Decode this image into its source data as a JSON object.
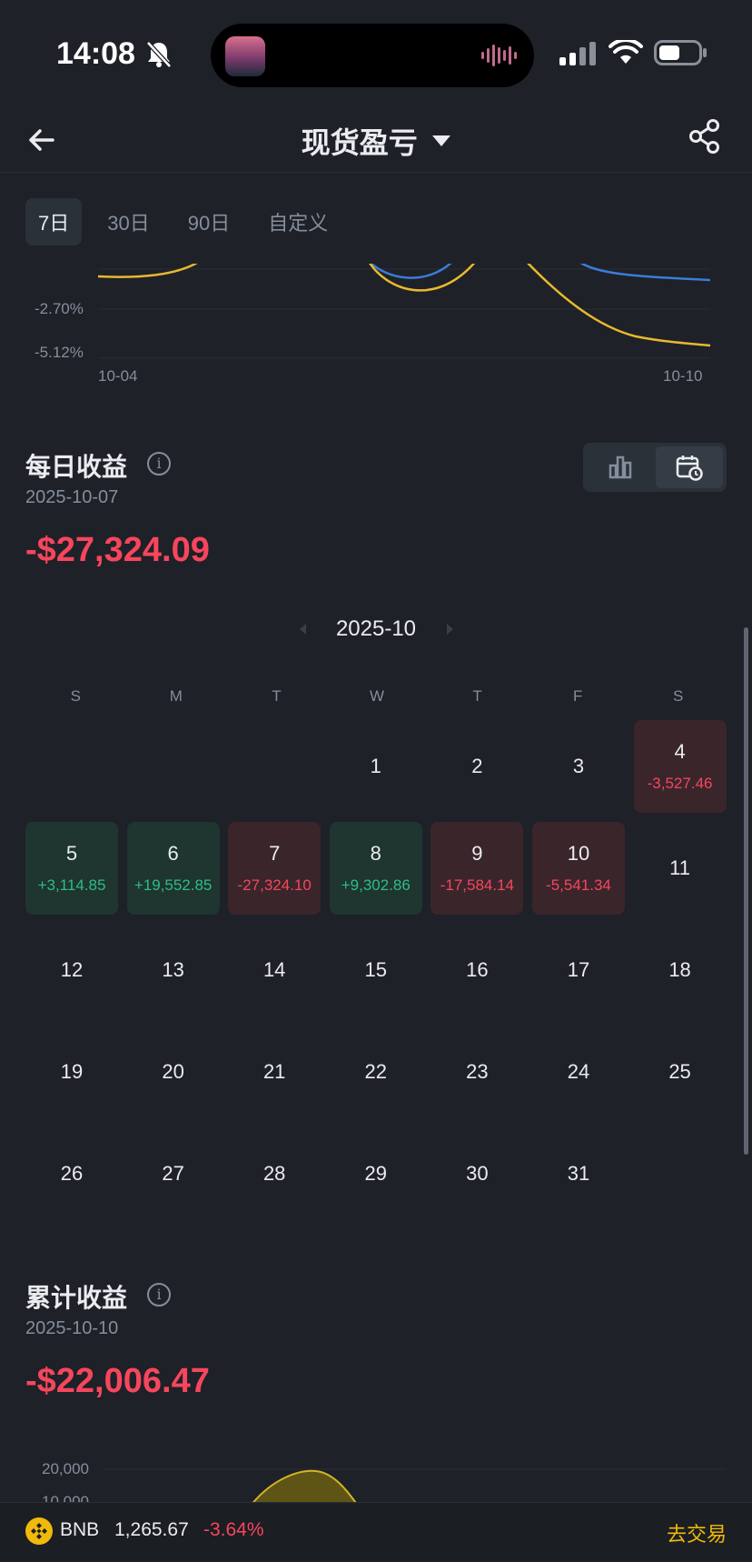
{
  "status_bar": {
    "time": "14:08",
    "icons": [
      "bell-off-icon",
      "signal-icon",
      "wifi-icon",
      "battery-icon"
    ]
  },
  "header": {
    "title": "现货盈亏",
    "icons": [
      "back-arrow-icon",
      "dropdown-caret-icon",
      "share-icon"
    ]
  },
  "range_tabs": [
    {
      "label": "7日",
      "active": true
    },
    {
      "label": "30日",
      "active": false
    },
    {
      "label": "90日",
      "active": false
    },
    {
      "label": "自定义",
      "active": false
    }
  ],
  "top_chart": {
    "y_labels": [
      "-2.70%",
      "-5.12%"
    ],
    "x_labels": [
      "10-04",
      "10-10"
    ],
    "colors": {
      "series_a": "#e8b92f",
      "series_b": "#3d7bd9"
    }
  },
  "daily": {
    "title": "每日收益",
    "date": "2025-10-07",
    "value": "-$27,324.09",
    "view_icons": [
      "bar-chart-icon",
      "calendar-icon"
    ],
    "month": "2025-10",
    "weekdays": [
      "S",
      "M",
      "T",
      "W",
      "T",
      "F",
      "S"
    ],
    "days": [
      {
        "day": "",
        "pnl": "",
        "type": "empty"
      },
      {
        "day": "",
        "pnl": "",
        "type": "empty"
      },
      {
        "day": "",
        "pnl": "",
        "type": "empty"
      },
      {
        "day": "1",
        "pnl": "",
        "type": "none"
      },
      {
        "day": "2",
        "pnl": "",
        "type": "none"
      },
      {
        "day": "3",
        "pnl": "",
        "type": "none"
      },
      {
        "day": "4",
        "pnl": "-3,527.46",
        "type": "neg"
      },
      {
        "day": "5",
        "pnl": "+3,114.85",
        "type": "pos"
      },
      {
        "day": "6",
        "pnl": "+19,552.85",
        "type": "pos"
      },
      {
        "day": "7",
        "pnl": "-27,324.10",
        "type": "neg"
      },
      {
        "day": "8",
        "pnl": "+9,302.86",
        "type": "pos"
      },
      {
        "day": "9",
        "pnl": "-17,584.14",
        "type": "neg"
      },
      {
        "day": "10",
        "pnl": "-5,541.34",
        "type": "neg"
      },
      {
        "day": "11",
        "pnl": "",
        "type": "none"
      },
      {
        "day": "12",
        "pnl": "",
        "type": "none"
      },
      {
        "day": "13",
        "pnl": "",
        "type": "none"
      },
      {
        "day": "14",
        "pnl": "",
        "type": "none"
      },
      {
        "day": "15",
        "pnl": "",
        "type": "none"
      },
      {
        "day": "16",
        "pnl": "",
        "type": "none"
      },
      {
        "day": "17",
        "pnl": "",
        "type": "none"
      },
      {
        "day": "18",
        "pnl": "",
        "type": "none"
      },
      {
        "day": "19",
        "pnl": "",
        "type": "none"
      },
      {
        "day": "20",
        "pnl": "",
        "type": "none"
      },
      {
        "day": "21",
        "pnl": "",
        "type": "none"
      },
      {
        "day": "22",
        "pnl": "",
        "type": "none"
      },
      {
        "day": "23",
        "pnl": "",
        "type": "none"
      },
      {
        "day": "24",
        "pnl": "",
        "type": "none"
      },
      {
        "day": "25",
        "pnl": "",
        "type": "none"
      },
      {
        "day": "26",
        "pnl": "",
        "type": "none"
      },
      {
        "day": "27",
        "pnl": "",
        "type": "none"
      },
      {
        "day": "28",
        "pnl": "",
        "type": "none"
      },
      {
        "day": "29",
        "pnl": "",
        "type": "none"
      },
      {
        "day": "30",
        "pnl": "",
        "type": "none"
      },
      {
        "day": "31",
        "pnl": "",
        "type": "none"
      }
    ],
    "colors": {
      "positive": "#2ebd85",
      "negative": "#f6465d"
    }
  },
  "cumulative": {
    "title": "累计收益",
    "date": "2025-10-10",
    "value": "-$22,006.47",
    "y_labels": [
      "20,000",
      "10,000"
    ]
  },
  "ticker": {
    "coin": "BNB",
    "price": "1,265.67",
    "change": "-3.64%",
    "trade_label": "去交易",
    "icon": "bnb-coin-icon"
  }
}
